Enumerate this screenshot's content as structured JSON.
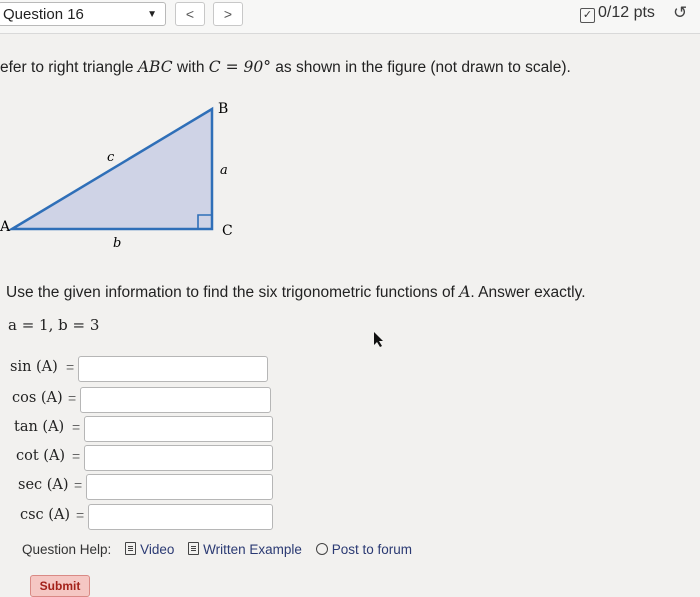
{
  "header": {
    "question_label": "Question 16",
    "prev_label": "<",
    "next_label": ">",
    "points": "0/12 pts",
    "redo_symbol": "↺"
  },
  "intro": {
    "prefix": "efer to right triangle",
    "triangle_name": "ABC",
    "with": "with",
    "condition": "C = 90°",
    "suffix": "as shown in the figure (not drawn to scale)."
  },
  "figure": {
    "vertex_a": "A",
    "vertex_b": "B",
    "vertex_c": "C",
    "side_a": "a",
    "side_b": "b",
    "side_c": "c",
    "fill": "#cfd3e6",
    "stroke": "#2f6fb8"
  },
  "instruction": {
    "text": "Use the given information to find the six trigonometric functions of",
    "var": "A",
    "suffix": ". Answer exactly."
  },
  "given": "a = 1, b = 3",
  "answers": [
    {
      "label": "sin (A)",
      "value": ""
    },
    {
      "label": "cos (A)",
      "value": ""
    },
    {
      "label": "tan (A)",
      "value": ""
    },
    {
      "label": "cot (A)",
      "value": ""
    },
    {
      "label": "sec (A)",
      "value": ""
    },
    {
      "label": "csc (A)",
      "value": ""
    }
  ],
  "help": {
    "label": "Question Help:",
    "video": "Video",
    "example": "Written Example",
    "forum": "Post to forum"
  },
  "submit_label": "Submit"
}
